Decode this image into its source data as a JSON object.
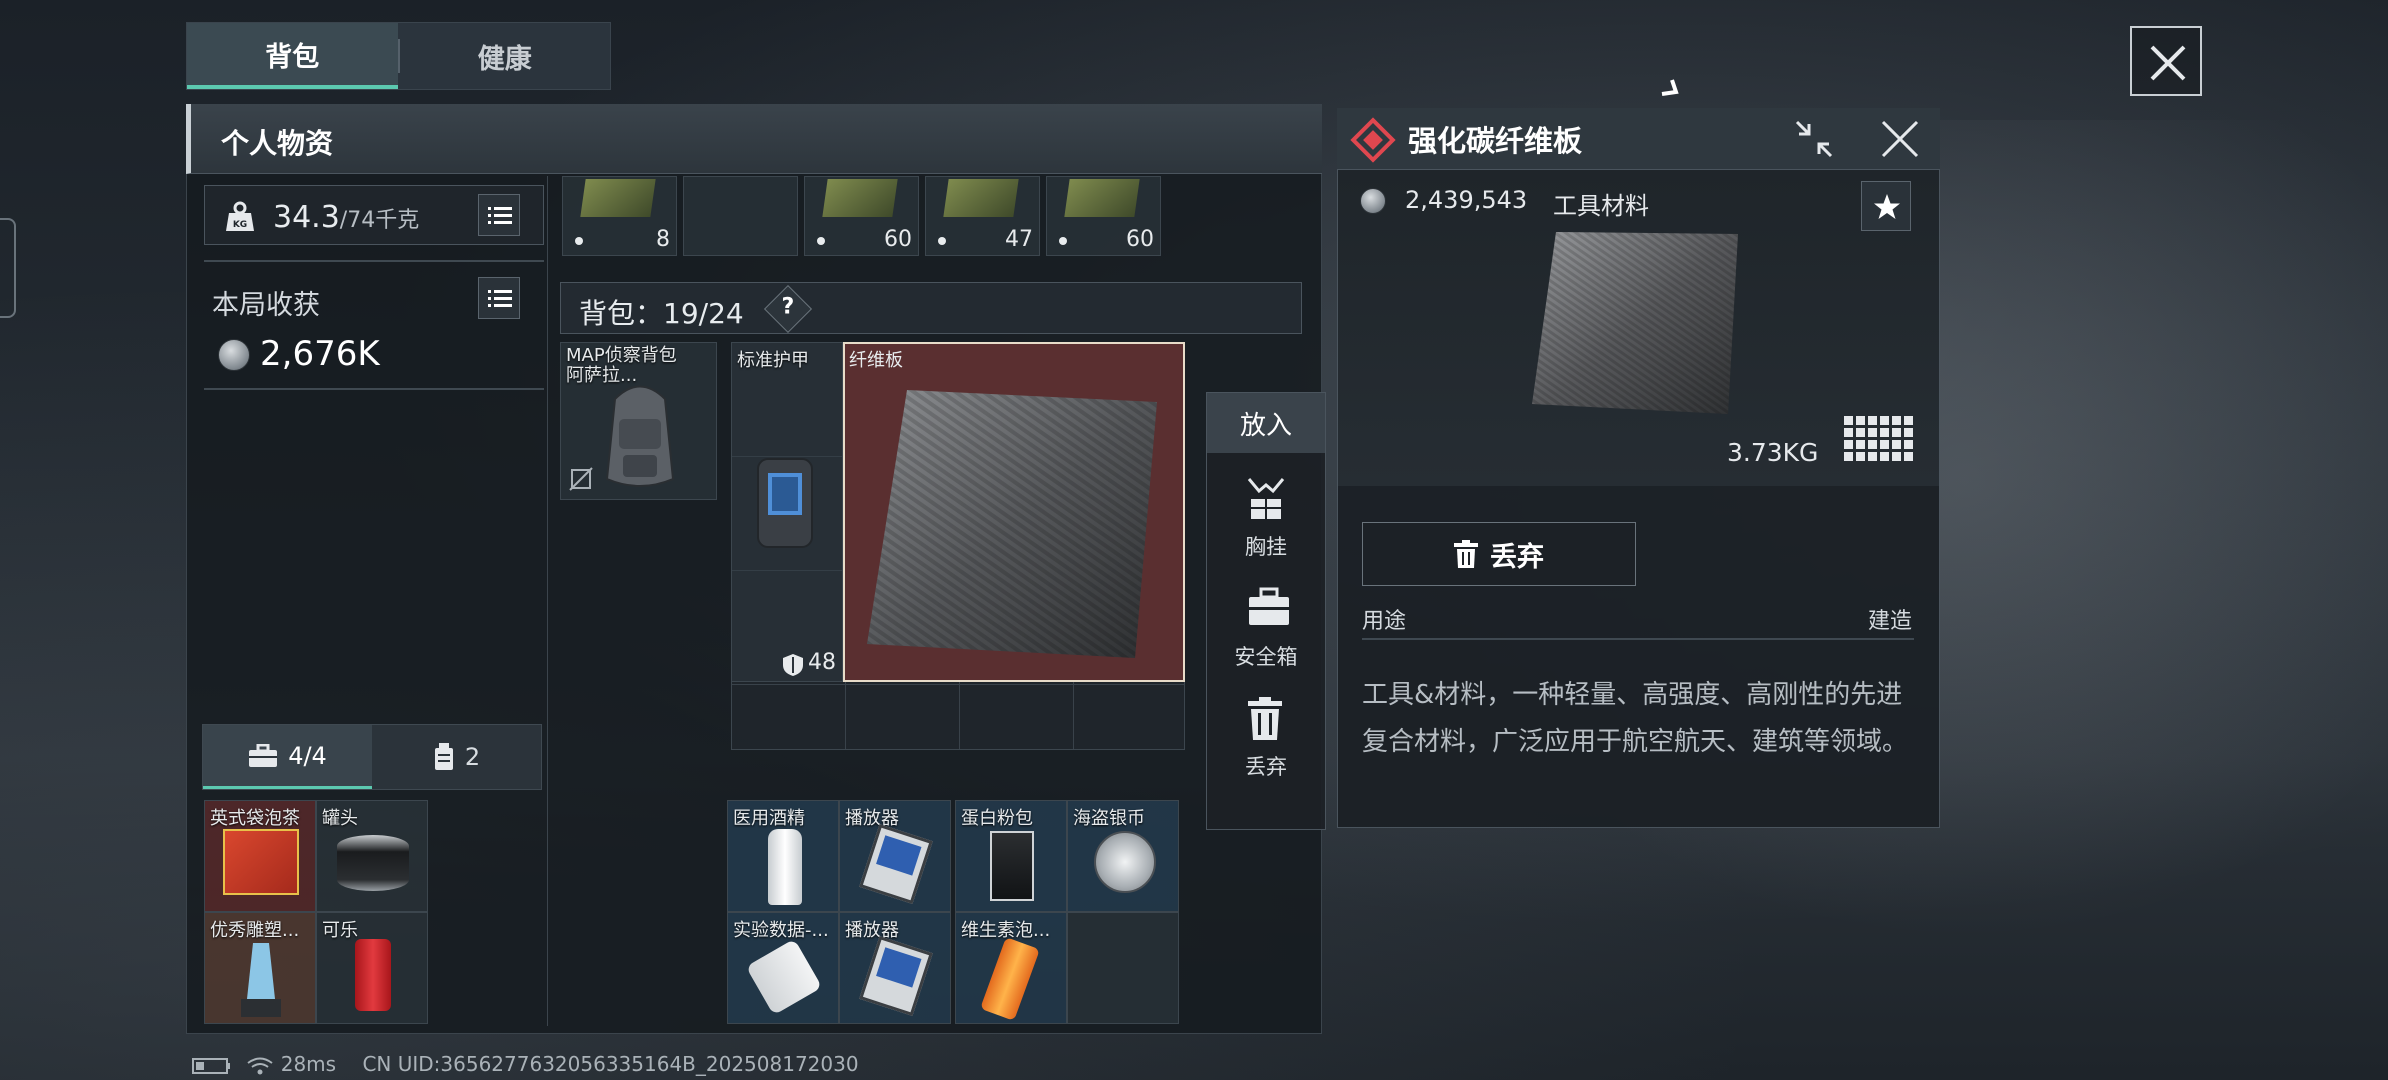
{
  "tabs": [
    {
      "label": "背包"
    },
    {
      "label": "健康"
    }
  ],
  "panel": {
    "title": "个人物资"
  },
  "weight": {
    "current": "34.3",
    "limit": "/74千克",
    "icon_text": "KG"
  },
  "harvest": {
    "title": "本局收获",
    "value": "2,676K"
  },
  "bottom_tabs": [
    {
      "label": "4/4",
      "icon": "briefcase-icon"
    },
    {
      "label": "2",
      "icon": "canister-icon"
    }
  ],
  "top_row_counts": [
    "8",
    "60",
    "47",
    "60"
  ],
  "backpack": {
    "label": "背包：19/24",
    "help": "?"
  },
  "slots": {
    "bag": "MAP侦察背包\n阿萨拉...",
    "armor": "标准护甲",
    "armor_value": "48",
    "fiber": "纤维板"
  },
  "pouch_items": [
    {
      "label": "英式袋泡茶"
    },
    {
      "label": "罐头"
    },
    {
      "label": "优秀雕塑..."
    },
    {
      "label": "可乐"
    }
  ],
  "container_items": [
    {
      "label": "医用酒精"
    },
    {
      "label": "播放器"
    },
    {
      "label": "蛋白粉包"
    },
    {
      "label": "海盗银币"
    },
    {
      "label": "实验数据-..."
    },
    {
      "label": "播放器"
    },
    {
      "label": "维生素泡..."
    }
  ],
  "put_menu": {
    "title": "放入",
    "items": [
      {
        "label": "胸挂",
        "icon": "chest-rig-icon"
      },
      {
        "label": "安全箱",
        "icon": "safe-box-icon"
      },
      {
        "label": "丢弃",
        "icon": "trash-icon"
      }
    ]
  },
  "detail": {
    "title": "强化碳纤维板",
    "price": "2,439,543",
    "type": "工具材料",
    "weight": "3.73KG",
    "discard": "丢弃",
    "use_label": "用途",
    "use_value": "建造",
    "description": "工具&材料，一种轻量、高强度、高刚性的先进复合材料，广泛应用于航空航天、建筑等领域。",
    "rarity_color": "#e0474f"
  },
  "status": {
    "ping": "28ms",
    "uid": "CN UID:3656277632056335164B_202508172030"
  },
  "colors": {
    "accent": "#5cc9b0",
    "highlight_bg": "#5a2f30"
  }
}
